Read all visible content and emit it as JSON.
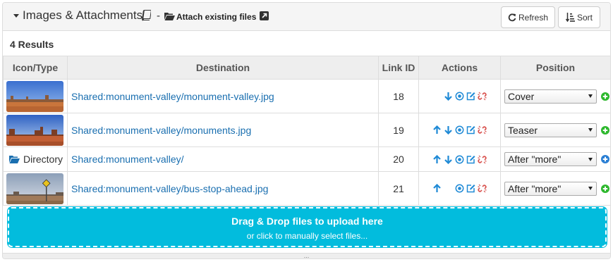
{
  "header": {
    "title": "Images & Attachments",
    "separator": "-",
    "attach_label": "Attach existing files",
    "refresh_label": "Refresh",
    "sort_label": "Sort"
  },
  "results_label": "4 Results",
  "table": {
    "columns": [
      "Icon/Type",
      "Destination",
      "Link ID",
      "Actions",
      "Position"
    ],
    "rows": [
      {
        "type": "image",
        "thumb": "desert-mesas",
        "destination": "Shared:monument-valley/monument-valley.jpg",
        "link_id": "18",
        "actions": [
          "arrow-down-icon",
          "target-icon",
          "edit-icon",
          "unlink-icon"
        ],
        "position": "Cover",
        "add_color": "green"
      },
      {
        "type": "image",
        "thumb": "buttes-red-sand",
        "destination": "Shared:monument-valley/monuments.jpg",
        "link_id": "19",
        "actions": [
          "arrow-up-icon",
          "arrow-down-icon",
          "target-icon",
          "edit-icon",
          "unlink-icon"
        ],
        "position": "Teaser",
        "add_color": "green"
      },
      {
        "type": "directory",
        "type_label": "Directory",
        "destination": "Shared:monument-valley/",
        "link_id": "20",
        "actions": [
          "arrow-up-icon",
          "arrow-down-icon",
          "target-icon",
          "edit-icon",
          "unlink-icon"
        ],
        "position": "After \"more\"",
        "add_color": "blue"
      },
      {
        "type": "image",
        "thumb": "bus-stop-sign",
        "destination": "Shared:monument-valley/bus-stop-ahead.jpg",
        "link_id": "21",
        "actions": [
          "arrow-up-icon",
          "target-icon",
          "edit-icon",
          "unlink-icon"
        ],
        "position": "After \"more\"",
        "add_color": "green"
      }
    ]
  },
  "dropzone": {
    "title": "Drag & Drop files to upload here",
    "subtitle": "or click to manually select files..."
  },
  "resize_handle": "...",
  "colors": {
    "link": "#1a6fb0",
    "action_blue": "#1f8ad6",
    "unlink_red": "#d9534f",
    "add_green": "#2eb82e",
    "add_blue": "#2a7fd4",
    "dropzone": "#02bcdd"
  }
}
